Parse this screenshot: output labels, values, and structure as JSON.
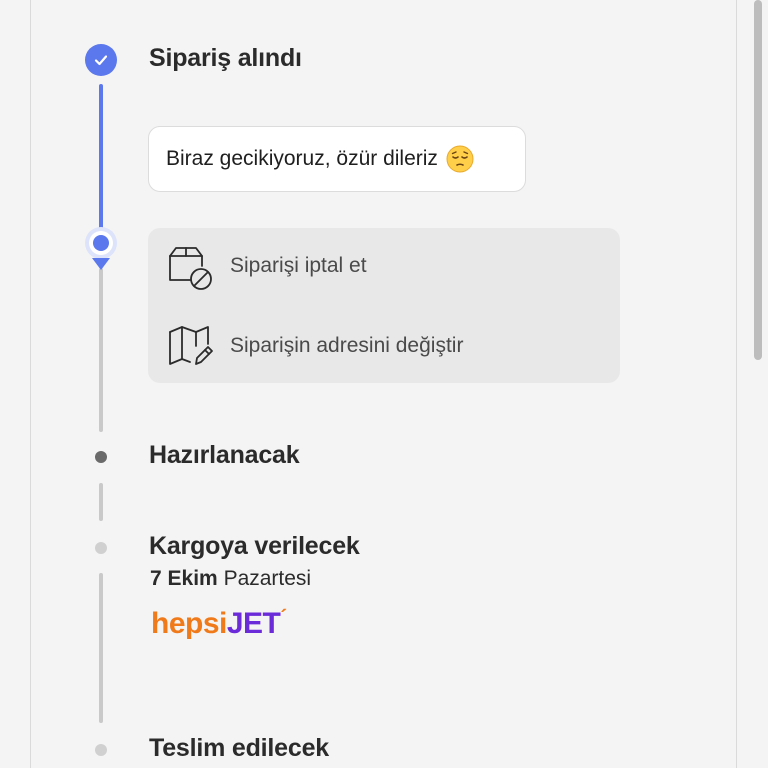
{
  "timeline": {
    "steps": [
      {
        "title": "Sipariş alındı"
      },
      {
        "title": "Hazırlanacak"
      },
      {
        "title": "Kargoya verilecek"
      },
      {
        "title": "Teslim edilecek"
      }
    ],
    "delay_message": "Biraz gecikiyoruz, özür dileriz",
    "delay_emoji_icon": "pensive-face-icon",
    "actions": [
      {
        "label": "Siparişi iptal et",
        "icon": "box-cancel-icon"
      },
      {
        "label": "Siparişin adresini değiştir",
        "icon": "map-edit-icon"
      }
    ],
    "shipping_date": {
      "bold": "7 Ekim",
      "rest": "Pazartesi"
    },
    "carrier": {
      "part1": "hepsi",
      "part2": "JET",
      "mark": "´"
    }
  },
  "colors": {
    "accent": "#5b78ec",
    "background": "#f4f4f4",
    "carrier_orange": "#f07a1a",
    "carrier_purple": "#6c2bd9"
  }
}
